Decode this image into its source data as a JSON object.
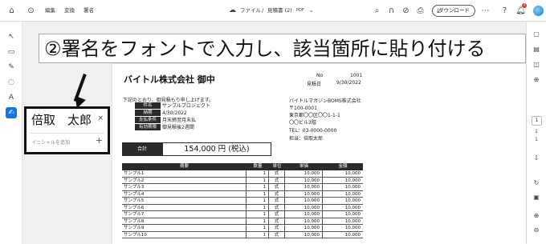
{
  "topbar": {
    "menu": [
      "編集",
      "変換",
      "署名"
    ],
    "breadcrumb_folder": "ファイル",
    "separator": "/",
    "filename": "見積書 (2)",
    "filetype": "PDF",
    "download_label": "ダウンロード",
    "notification_count": "1"
  },
  "callout_text": "②署名をフォントで入力し、該当箇所に貼り付ける",
  "signature_panel": {
    "name": "倍取　太郎",
    "initials_placeholder": "イニシャルを追加",
    "close_symbol": "×",
    "add_symbol": "+"
  },
  "document": {
    "title": "バイトル株式会社 御中",
    "no_label": "No",
    "no_value": "1001",
    "date_label": "見積日",
    "date_value": "9/30/2022",
    "intro": "下記のとおり、御見積もり申し上げます。",
    "info": [
      {
        "label": "件名",
        "value": "サンプルプロジェクト"
      },
      {
        "label": "納期",
        "value": "4/30/2022"
      },
      {
        "label": "支払条件",
        "value": "月末締翌月末払"
      },
      {
        "label": "有効期限",
        "value": "御見積後2週間"
      }
    ],
    "company": {
      "name": "バイトルマガジンBOMS株式会社",
      "postal": "〒100-0001",
      "address1": "東京都〇〇区〇〇1-1-1",
      "address2": "〇〇ビル3階",
      "tel": "TEL：03-0000-0000",
      "person": "担当：倍取太郎"
    },
    "total_label": "合計",
    "total_value": "154,000 円 (税込)",
    "item_headers": [
      "摘要",
      "数量",
      "単位",
      "単価",
      "金額"
    ],
    "items": [
      {
        "name": "サンプル1",
        "qty": "1",
        "unit": "式",
        "price": "10,000",
        "amount": "10,000"
      },
      {
        "name": "サンプル2",
        "qty": "1",
        "unit": "式",
        "price": "10,000",
        "amount": "10,000"
      },
      {
        "name": "サンプル3",
        "qty": "1",
        "unit": "式",
        "price": "10,000",
        "amount": "10,000"
      },
      {
        "name": "サンプル4",
        "qty": "1",
        "unit": "式",
        "price": "10,000",
        "amount": "10,000"
      },
      {
        "name": "サンプル5",
        "qty": "1",
        "unit": "式",
        "price": "10,000",
        "amount": "10,000"
      },
      {
        "name": "サンプル6",
        "qty": "1",
        "unit": "式",
        "price": "10,000",
        "amount": "10,000"
      },
      {
        "name": "サンプル7",
        "qty": "1",
        "unit": "式",
        "price": "10,000",
        "amount": "10,000"
      },
      {
        "name": "サンプル8",
        "qty": "1",
        "unit": "式",
        "price": "10,000",
        "amount": "10,000"
      },
      {
        "name": "サンプル9",
        "qty": "1",
        "unit": "式",
        "price": "10,000",
        "amount": "10,000"
      },
      {
        "name": "サンプル10",
        "qty": "1",
        "unit": "式",
        "price": "10,000",
        "amount": "10,000"
      }
    ]
  },
  "right_panel": {
    "page_current": "1",
    "page_divider": "1",
    "page_total": "1"
  }
}
